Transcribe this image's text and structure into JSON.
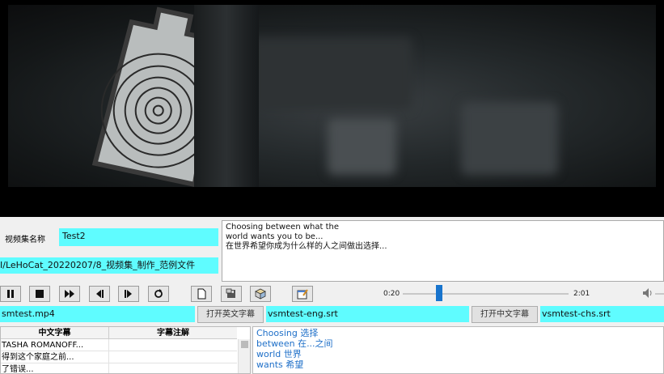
{
  "video": {
    "description_icon": "target-practice-frame"
  },
  "project": {
    "name_label": "视频集名称",
    "name_value": "Test2",
    "path_value": "I/LeHoCat_20220207/8_视频集_制作_范例文件"
  },
  "subtitle_preview": {
    "line1": "Choosing between what the",
    "line2": "world wants you to be...",
    "line3": "在世界希望你成为什么样的人之间做出选择..."
  },
  "player": {
    "current_time": "0:20",
    "total_time": "2:01",
    "progress": 0.22
  },
  "files": {
    "video_file": "smtest.mp4",
    "open_eng_label": "打开英文字幕",
    "eng_file": "vsmtest-eng.srt",
    "open_chs_label": "打开中文字幕",
    "chs_file": "vsmtest-chs.srt"
  },
  "table": {
    "col_chinese": "中文字幕",
    "col_notes": "字幕注解",
    "rows": [
      {
        "chinese": "TASHA ROMANOFF...",
        "notes": ""
      },
      {
        "chinese": "得到这个家庭之前...",
        "notes": ""
      },
      {
        "chinese": "了错误...",
        "notes": ""
      }
    ]
  },
  "word_list": [
    "Choosing 选择",
    "between 在...之间",
    "world 世界",
    "wants 希望"
  ],
  "colors": {
    "field_bg": "#5ffcff",
    "slider_thumb": "#1874cd",
    "word_text": "#1e6fc8"
  }
}
